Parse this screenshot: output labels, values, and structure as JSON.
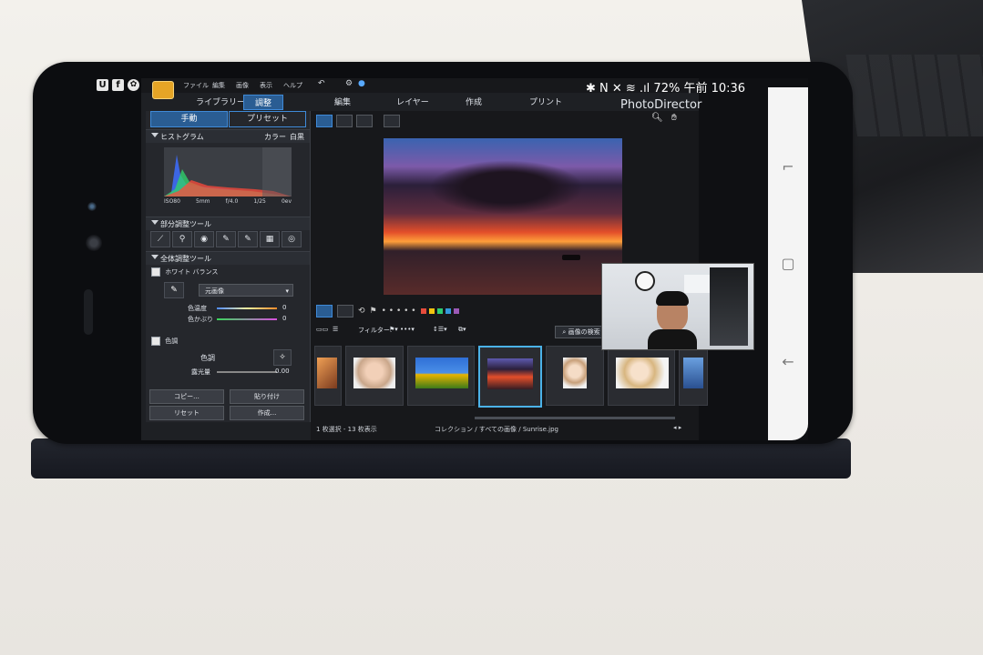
{
  "status": {
    "left_icons": [
      "U",
      "f",
      "✿"
    ],
    "right": "✱ N ✕ ≋ .ıl 72% 午前 10:36"
  },
  "app": {
    "title": "PhotoDirector",
    "menu": [
      "ファイル",
      "編集",
      "画像",
      "表示",
      "ヘルプ"
    ],
    "tabs": [
      "ライブラリー",
      "調整",
      "編集",
      "レイヤー",
      "作成",
      "プリント"
    ],
    "active_tab": "調整"
  },
  "left_panel": {
    "subtabs": [
      "手動",
      "プリセット"
    ],
    "histogram": {
      "label": "ヒストグラム",
      "mode": "カラー",
      "mode2": "白黒",
      "meta": [
        "ISO80",
        "5mm",
        "f/4.0",
        "1/25",
        "0ev"
      ]
    },
    "local_tools": {
      "label": "部分調整ツール",
      "tools": [
        "⟋",
        "⚲",
        "◉",
        "✎",
        "✎",
        "▦",
        "◎"
      ]
    },
    "global_tools": {
      "label": "全体調整ツール"
    },
    "white_balance": {
      "label": "ホワイト バランス",
      "value": "元画像",
      "temperature": {
        "label": "色温度",
        "value": "0"
      },
      "tint": {
        "label": "色かぶり",
        "value": "0"
      }
    },
    "tone": {
      "label": "色調",
      "sublabel": "色調",
      "exposure": {
        "label": "露光量",
        "value": "0.00"
      }
    },
    "buttons": {
      "copy": "コピー...",
      "paste": "貼り付け",
      "reset": "リセット",
      "create": "作成..."
    }
  },
  "center": {
    "filter_label": "フィルター:",
    "search_label": "画像の検索",
    "color_labels": [
      "#e74c3c",
      "#f1c40f",
      "#2ecc71",
      "#3498db",
      "#9b59b6"
    ],
    "selection_status": "1 枚選択 - 13 枚表示",
    "path": "コレクション / すべての画像 / Sunrise.jpg"
  },
  "navbar": {
    "icons": [
      "recent-apps-icon",
      "home-icon",
      "back-icon"
    ]
  }
}
